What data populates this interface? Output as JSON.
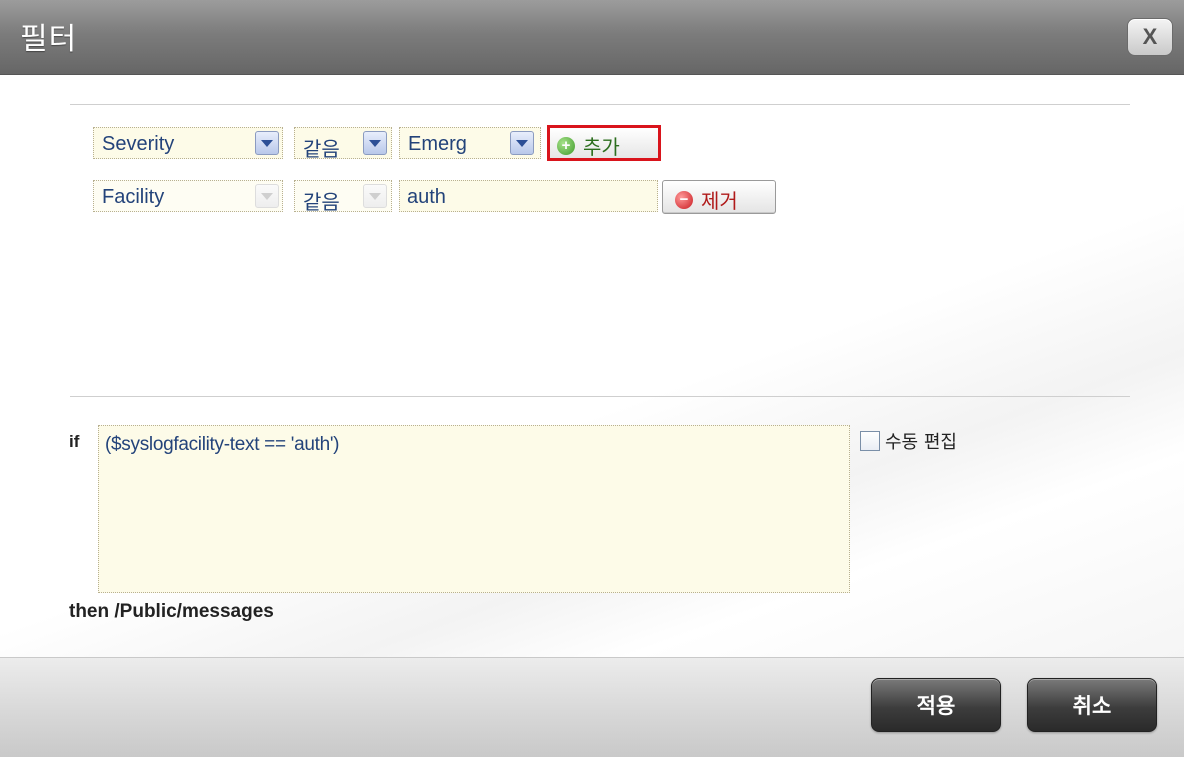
{
  "dialog": {
    "title": "필터",
    "close_label": "X"
  },
  "filters": {
    "rows": [
      {
        "field": "Severity",
        "operator": "같음",
        "value": "Emerg",
        "action_label": "추가"
      },
      {
        "field": "Facility",
        "operator": "같음",
        "value": "auth",
        "action_label": "제거"
      }
    ]
  },
  "expression": {
    "if_label": "if",
    "text": "($syslogfacility-text == 'auth')",
    "manual_edit_label": "수동 편집",
    "then_text": "then /Public/messages"
  },
  "footer": {
    "apply_label": "적용",
    "cancel_label": "취소"
  },
  "colors": {
    "add_highlight": "#d9141c",
    "field_background": "#fdfbe8",
    "field_text": "#23437a"
  }
}
